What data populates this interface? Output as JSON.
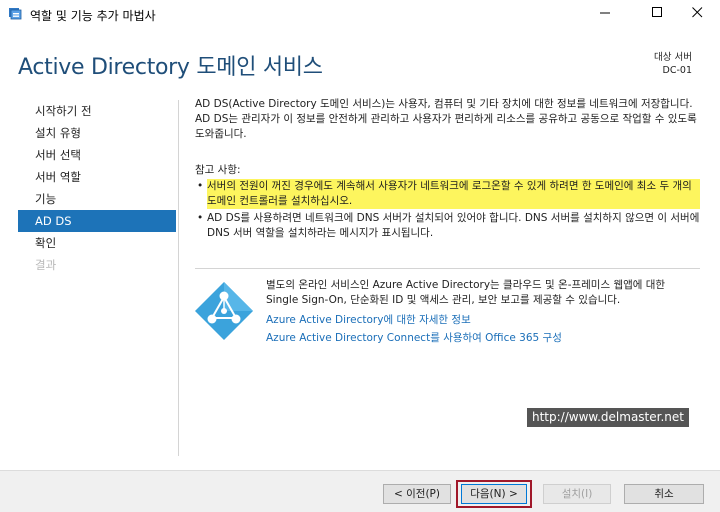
{
  "window": {
    "title": "역할 및 기능 추가 마법사",
    "app_icon": "server-manager-icon",
    "controls": [
      "minimize-icon",
      "maximize-icon",
      "close-icon"
    ]
  },
  "header": {
    "title": "Active Directory 도메인 서비스",
    "target_label": "대상 서버",
    "target_value": "DC-01"
  },
  "nav": {
    "items": [
      {
        "label": "시작하기 전",
        "state": "normal"
      },
      {
        "label": "설치 유형",
        "state": "normal"
      },
      {
        "label": "서버 선택",
        "state": "normal"
      },
      {
        "label": "서버 역할",
        "state": "normal"
      },
      {
        "label": "기능",
        "state": "normal"
      },
      {
        "label": "AD DS",
        "state": "active"
      },
      {
        "label": "확인",
        "state": "normal"
      },
      {
        "label": "결과",
        "state": "disabled"
      }
    ]
  },
  "content": {
    "intro": "AD DS(Active Directory 도메인 서비스)는 사용자, 컴퓨터 및 기타 장치에 대한 정보를 네트워크에 저장합니다. AD DS는 관리자가 이 정보를 안전하게 관리하고 사용자가 편리하게 리소스를 공유하고 공동으로 작업할 수 있도록 도와줍니다.",
    "notes_title": "참고 사항:",
    "notes": [
      "서버의 전원이 꺼진 경우에도 계속해서 사용자가 네트워크에 로그온할 수 있게 하려면 한 도메인에 최소 두 개의 도메인 컨트롤러를 설치하십시오.",
      "AD DS를 사용하려면 네트워크에 DNS 서버가 설치되어 있어야 합니다. DNS 서버를 설치하지 않으면 이 서버에 DNS 서버 역할을 설치하라는 메시지가 표시됩니다."
    ],
    "azure_text": "별도의 온라인 서비스인 Azure Active Directory는 클라우드 및 온-프레미스 웹앱에 대한 Single Sign-On, 단순화된 ID 및 액세스 관리, 보안 보고를 제공할 수 있습니다.",
    "azure_icon": "azure-ad-icon",
    "links": [
      "Azure Active Directory에 대한 자세한 정보",
      "Azure Active Directory Connect를 사용하여 Office 365 구성"
    ]
  },
  "watermark": "http://www.delmaster.net",
  "footer": {
    "prev": "< 이전(P)",
    "next": "다음(N) >",
    "install": "설치(I)",
    "cancel": "취소"
  },
  "colors": {
    "accent": "#1d73b8",
    "title": "#1f4e79",
    "link": "#1a6eb8",
    "highlight": "#fdf55e",
    "next_outline": "#a0182a"
  }
}
